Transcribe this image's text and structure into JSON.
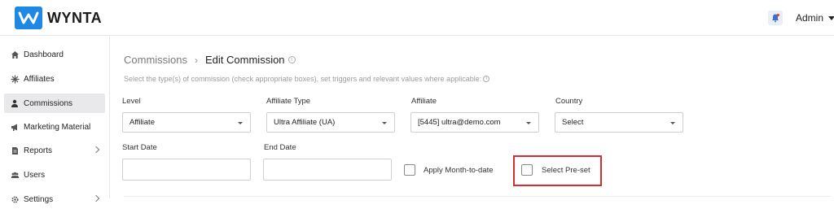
{
  "header": {
    "logo_text": "WYNTA",
    "user_label": "Admin",
    "icons": [
      "logo-w-icon",
      "notification-bell-icon",
      "caret-down-icon"
    ],
    "accent_color": "#1e88e5"
  },
  "sidebar": {
    "items": [
      {
        "label": "Dashboard",
        "icon": "home-icon",
        "active": false,
        "has_submenu": false
      },
      {
        "label": "Affiliates",
        "icon": "asterisk-icon",
        "active": false,
        "has_submenu": false
      },
      {
        "label": "Commissions",
        "icon": "user-money-icon",
        "active": true,
        "has_submenu": false
      },
      {
        "label": "Marketing Material",
        "icon": "megaphone-icon",
        "active": false,
        "has_submenu": false
      },
      {
        "label": "Reports",
        "icon": "document-icon",
        "active": false,
        "has_submenu": true
      },
      {
        "label": "Users",
        "icon": "users-icon",
        "active": false,
        "has_submenu": false
      },
      {
        "label": "Settings",
        "icon": "gear-icon",
        "active": false,
        "has_submenu": true
      }
    ]
  },
  "main": {
    "breadcrumb": {
      "parent": "Commissions",
      "separator": "›",
      "current": "Edit Commission"
    },
    "instructions": "Select the type(s) of commission (check appropriate boxes), set triggers and relevant values where applicable:",
    "fields": {
      "level": {
        "label": "Level",
        "value": "Affiliate"
      },
      "affiliate_type": {
        "label": "Affiliate Type",
        "value": "Ultra Affiliate (UA)"
      },
      "affiliate": {
        "label": "Affiliate",
        "value": "[5445] ultra@demo.com"
      },
      "country": {
        "label": "Country",
        "value": "Select"
      },
      "start_date": {
        "label": "Start Date",
        "value": ""
      },
      "end_date": {
        "label": "End Date",
        "value": ""
      }
    },
    "checkboxes": {
      "apply_mtd": {
        "label": "Apply Month-to-date",
        "checked": false
      },
      "select_preset": {
        "label": "Select Pre-set",
        "checked": false,
        "highlight_color": "#d32f2f"
      }
    }
  }
}
